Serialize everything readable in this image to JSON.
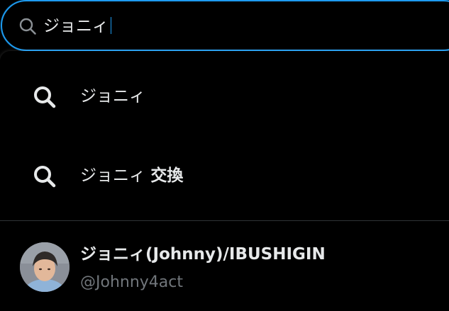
{
  "search": {
    "query": "ジョニィ"
  },
  "suggestions": [
    {
      "text": "ジョニィ",
      "bold_suffix": ""
    },
    {
      "text": "ジョニィ",
      "bold_suffix": "交換"
    }
  ],
  "user": {
    "name": "ジョニィ(Johnny)/IBUSHIGIN",
    "handle": "@Johnny4act"
  },
  "colors": {
    "accent": "#1d9bf0",
    "text_primary": "#e7e9ea",
    "text_secondary": "#71767b",
    "background": "#000000",
    "divider": "#2f3336"
  },
  "icons": {
    "search_bar": "search-icon",
    "suggestion": "search-icon"
  }
}
